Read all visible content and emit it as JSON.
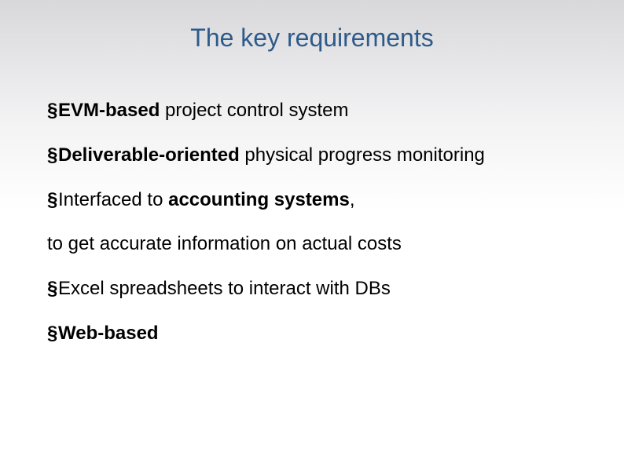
{
  "title": "The key requirements",
  "bullet_char": "§",
  "lines": {
    "l1_bold": "EVM-based",
    "l1_rest": " project control system",
    "l2_bold": "Deliverable-oriented",
    "l2_rest": " physical progress monitoring",
    "l3_pre": "Interfaced to ",
    "l3_bold": "accounting systems",
    "l3_post": ",",
    "l4": "to get accurate information on actual costs",
    "l5": "Excel spreadsheets to interact with DBs",
    "l6_bold": "Web-based"
  }
}
